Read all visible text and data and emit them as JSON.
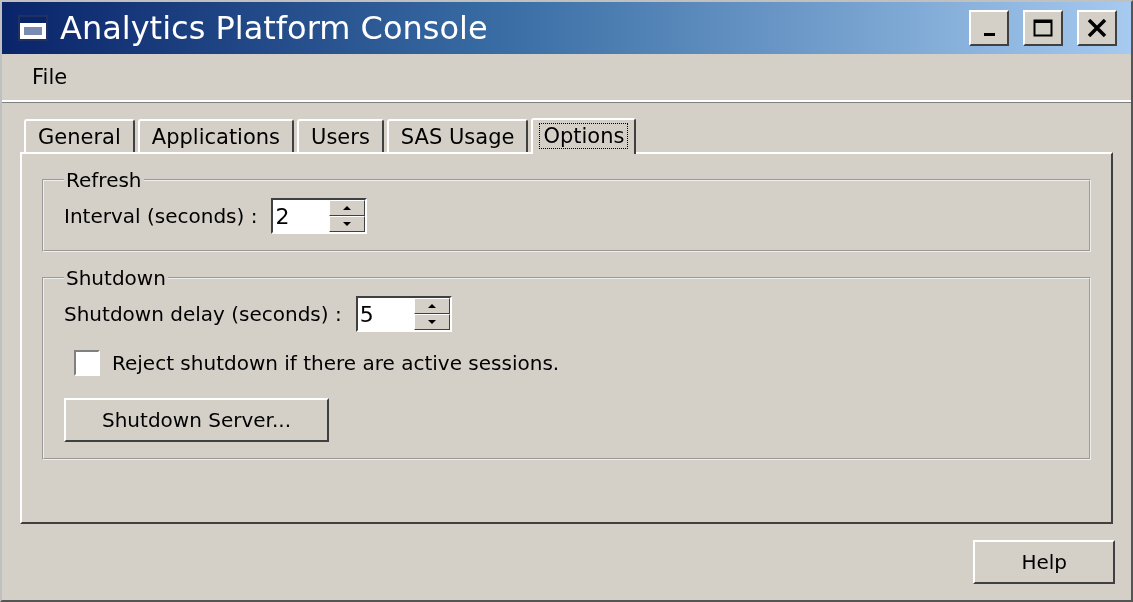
{
  "window": {
    "title": "Analytics Platform Console"
  },
  "menu": [
    {
      "label": "File"
    }
  ],
  "tabs": [
    {
      "label": "General",
      "selected": false
    },
    {
      "label": "Applications",
      "selected": false
    },
    {
      "label": "Users",
      "selected": false
    },
    {
      "label": "SAS Usage",
      "selected": false
    },
    {
      "label": "Options",
      "selected": true
    }
  ],
  "groups": [
    {
      "title": "Refresh",
      "fields": [
        {
          "kind": "spinner",
          "label": "Interval (seconds) :",
          "value": "2"
        }
      ]
    },
    {
      "title": "Shutdown",
      "fields": [
        {
          "kind": "spinner",
          "label": "Shutdown delay (seconds) :",
          "value": "5"
        },
        {
          "kind": "checkbox",
          "label": "Reject shutdown if there are active sessions.",
          "checked": false
        },
        {
          "kind": "button",
          "label": "Shutdown Server..."
        }
      ]
    }
  ],
  "buttons": [
    {
      "label": "Help"
    }
  ]
}
